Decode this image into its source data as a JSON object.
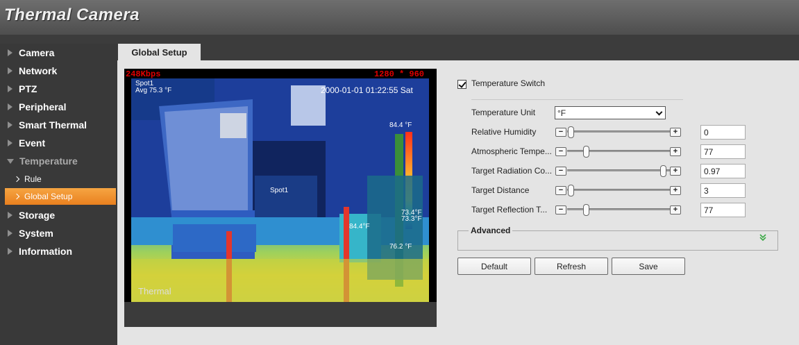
{
  "app": {
    "title": "Thermal Camera"
  },
  "sidebar": {
    "items": [
      {
        "label": "Camera"
      },
      {
        "label": "Network"
      },
      {
        "label": "PTZ"
      },
      {
        "label": "Peripheral"
      },
      {
        "label": "Smart Thermal"
      },
      {
        "label": "Event"
      },
      {
        "label": "Temperature",
        "expanded": true
      },
      {
        "label": "Storage"
      },
      {
        "label": "System"
      },
      {
        "label": "Information"
      }
    ],
    "sub_items": [
      {
        "label": "Rule"
      },
      {
        "label": "Global Setup",
        "active": true
      }
    ]
  },
  "tabs": [
    {
      "label": "Global Setup",
      "active": true
    }
  ],
  "video": {
    "bitrate": "248Kbps",
    "resolution": "1280 * 960",
    "timestamp": "2000-01-01 01:22:55 Sat",
    "spot_name": "Spot1",
    "spot_avg": "Avg 75.3 °F",
    "max_label": "84.4 °F",
    "scale_label_1": "73.4°F",
    "scale_label_2": "73.3°F",
    "box_label": "84.4°F",
    "min_label": "76.2 °F",
    "spot_marker": "Spot1",
    "channel_name": "Thermal"
  },
  "form": {
    "temperature_switch": {
      "label": "Temperature Switch",
      "checked": true
    },
    "temperature_unit": {
      "label": "Temperature Unit",
      "value": "°F"
    },
    "relative_humidity": {
      "label": "Relative Humidity",
      "value": "0",
      "fraction": 0.0
    },
    "atmospheric_temp": {
      "label": "Atmospheric Tempe...",
      "value": "77",
      "fraction": 0.16
    },
    "target_radiation": {
      "label": "Target Radiation Co...",
      "value": "0.97",
      "fraction": 0.97
    },
    "target_distance": {
      "label": "Target Distance",
      "value": "3",
      "fraction": 0.0
    },
    "target_reflection": {
      "label": "Target Reflection T...",
      "value": "77",
      "fraction": 0.16
    },
    "advanced_label": "Advanced"
  },
  "buttons": {
    "default": "Default",
    "refresh": "Refresh",
    "save": "Save"
  },
  "icons": {
    "minus": "−",
    "plus": "+",
    "expand": "»"
  },
  "colors": {
    "accent": "#f29a35",
    "header": "#5e5e5e",
    "sidebar": "#393939",
    "video_text": "#e00000"
  }
}
